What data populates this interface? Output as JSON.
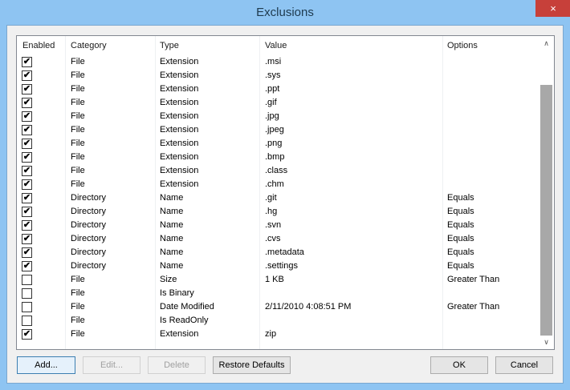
{
  "window": {
    "title": "Exclusions",
    "close_icon": "×"
  },
  "columns": [
    "Enabled",
    "Category",
    "Type",
    "Value",
    "Options"
  ],
  "rows": [
    {
      "enabled": true,
      "category": "File",
      "type": "Extension",
      "value": ".msi",
      "options": ""
    },
    {
      "enabled": true,
      "category": "File",
      "type": "Extension",
      "value": ".sys",
      "options": ""
    },
    {
      "enabled": true,
      "category": "File",
      "type": "Extension",
      "value": ".ppt",
      "options": ""
    },
    {
      "enabled": true,
      "category": "File",
      "type": "Extension",
      "value": ".gif",
      "options": ""
    },
    {
      "enabled": true,
      "category": "File",
      "type": "Extension",
      "value": ".jpg",
      "options": ""
    },
    {
      "enabled": true,
      "category": "File",
      "type": "Extension",
      "value": ".jpeg",
      "options": ""
    },
    {
      "enabled": true,
      "category": "File",
      "type": "Extension",
      "value": ".png",
      "options": ""
    },
    {
      "enabled": true,
      "category": "File",
      "type": "Extension",
      "value": ".bmp",
      "options": ""
    },
    {
      "enabled": true,
      "category": "File",
      "type": "Extension",
      "value": ".class",
      "options": ""
    },
    {
      "enabled": true,
      "category": "File",
      "type": "Extension",
      "value": ".chm",
      "options": ""
    },
    {
      "enabled": true,
      "category": "Directory",
      "type": "Name",
      "value": ".git",
      "options": "Equals"
    },
    {
      "enabled": true,
      "category": "Directory",
      "type": "Name",
      "value": ".hg",
      "options": "Equals"
    },
    {
      "enabled": true,
      "category": "Directory",
      "type": "Name",
      "value": ".svn",
      "options": "Equals"
    },
    {
      "enabled": true,
      "category": "Directory",
      "type": "Name",
      "value": ".cvs",
      "options": "Equals"
    },
    {
      "enabled": true,
      "category": "Directory",
      "type": "Name",
      "value": ".metadata",
      "options": "Equals"
    },
    {
      "enabled": true,
      "category": "Directory",
      "type": "Name",
      "value": ".settings",
      "options": "Equals"
    },
    {
      "enabled": false,
      "category": "File",
      "type": "Size",
      "value": "1 KB",
      "options": "Greater Than"
    },
    {
      "enabled": false,
      "category": "File",
      "type": "Is Binary",
      "value": "",
      "options": ""
    },
    {
      "enabled": false,
      "category": "File",
      "type": "Date Modified",
      "value": "2/11/2010 4:08:51 PM",
      "options": "Greater Than"
    },
    {
      "enabled": false,
      "category": "File",
      "type": "Is ReadOnly",
      "value": "",
      "options": ""
    },
    {
      "enabled": true,
      "category": "File",
      "type": "Extension",
      "value": "zip",
      "options": ""
    }
  ],
  "buttons": {
    "add": "Add...",
    "edit": "Edit...",
    "delete": "Delete",
    "restore": "Restore Defaults",
    "ok": "OK",
    "cancel": "Cancel"
  },
  "check_glyph": "✔"
}
